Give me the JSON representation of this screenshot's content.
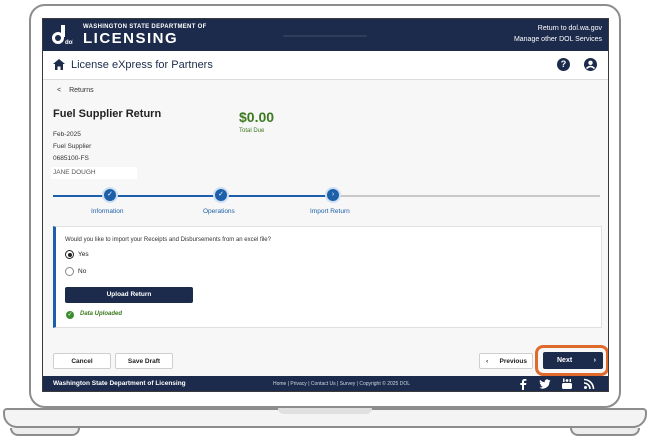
{
  "banner": {
    "agency_top": "WASHINGTON STATE DEPARTMENT OF",
    "agency_main": "LICENSING",
    "logo_initials": "dol",
    "link_return": "Return to dol.wa.gov",
    "link_services": "Manage other DOL Services"
  },
  "appbar": {
    "title": "License eXpress for Partners",
    "help_symbol": "?"
  },
  "breadcrumb": {
    "back_label": "Returns",
    "chevron": "<"
  },
  "return": {
    "title": "Fuel Supplier Return",
    "period": "Feb-2025",
    "type": "Fuel Supplier",
    "license_number": "0685100-FS",
    "name": "JANE DOUGH",
    "total_amount": "$0.00",
    "total_label": "Total Due"
  },
  "stepper": {
    "steps": [
      {
        "label": "Information",
        "state": "complete",
        "symbol": "✓"
      },
      {
        "label": "Operations",
        "state": "complete",
        "symbol": "✓"
      },
      {
        "label": "Import Return",
        "state": "current",
        "symbol": "›"
      }
    ]
  },
  "import": {
    "question": "Would you like to import your Receipts and Disbursements from an excel file?",
    "options": [
      {
        "label": "Yes",
        "selected": true
      },
      {
        "label": "No",
        "selected": false
      }
    ],
    "upload_label": "Upload Return",
    "status_symbol": "✓",
    "status_text": "Data Uploaded"
  },
  "actions": {
    "cancel_label": "Cancel",
    "save_draft_label": "Save Draft",
    "previous_label": "Previous",
    "previous_chevron": "‹",
    "next_label": "Next",
    "next_chevron": "›"
  },
  "footer": {
    "title": "Washington State Department of Licensing",
    "links": "Home | Privacy | Contact Us | Survey | Copyright © 2025 DOL",
    "social": [
      "facebook-icon",
      "twitter-icon",
      "youtube-icon",
      "rss-icon"
    ]
  },
  "colors": {
    "navy": "#1c2b4b",
    "step_blue": "#1d5fa8",
    "success_green": "#3c7a1f",
    "highlight_orange": "#e06a2c"
  }
}
